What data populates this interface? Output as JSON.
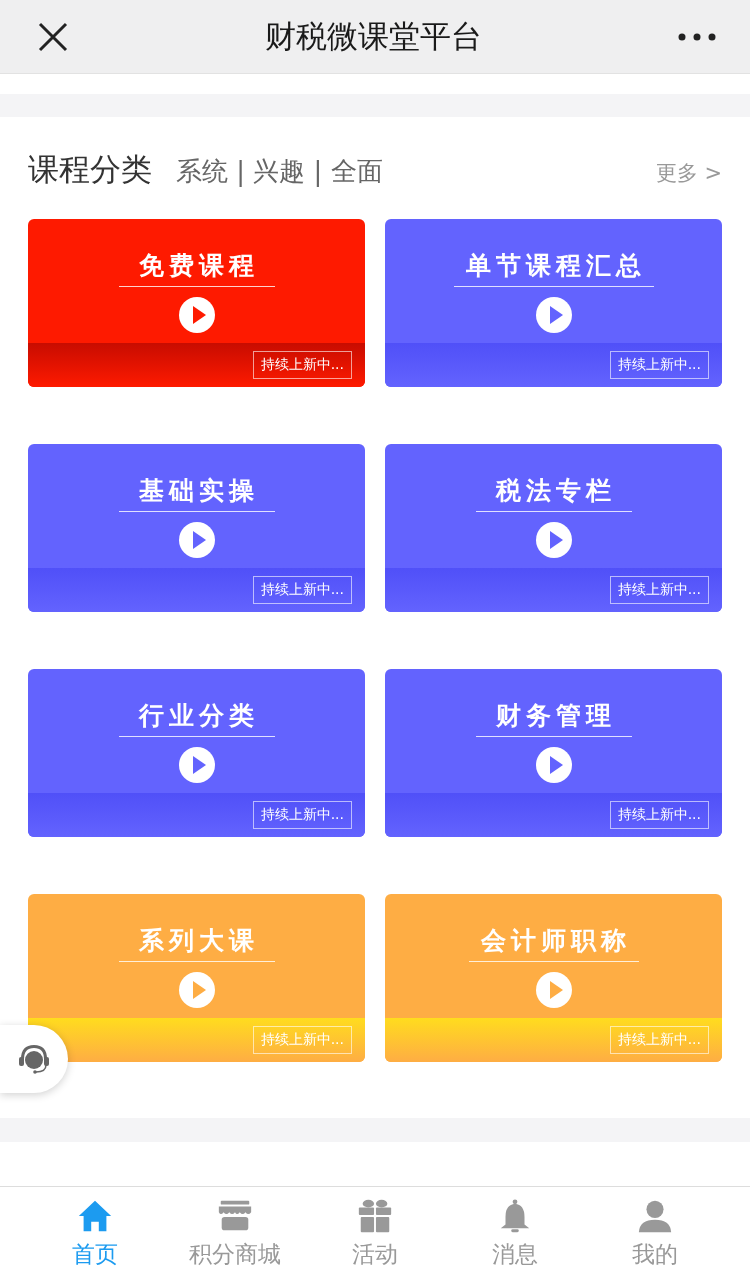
{
  "header": {
    "title": "财税微课堂平台"
  },
  "section": {
    "title": "课程分类",
    "subtitle": "系统 | 兴趣 | 全面",
    "more": "更多 >"
  },
  "cards": [
    {
      "title": "免费课程",
      "badge": "持续上新中...",
      "color": "#fe1a00",
      "band": {
        "color": "#c80c00"
      }
    },
    {
      "title": "单节课程汇总",
      "badge": "持续上新中...",
      "color": "#6363fe",
      "band": {
        "color": "#5050f8"
      }
    },
    {
      "title": "基础实操",
      "badge": "持续上新中...",
      "color": "#6363fe",
      "band": {
        "color": "#5050f8"
      }
    },
    {
      "title": "税法专栏",
      "badge": "持续上新中...",
      "color": "#6363fe",
      "band": {
        "color": "#5050f8"
      }
    },
    {
      "title": "行业分类",
      "badge": "持续上新中...",
      "color": "#6363fe",
      "band": {
        "color": "#5050f8"
      }
    },
    {
      "title": "财务管理",
      "badge": "持续上新中...",
      "color": "#6363fe",
      "band": {
        "color": "#5050f8"
      }
    },
    {
      "title": "系列大课",
      "badge": "持续上新中...",
      "color": "#fead44",
      "band": {
        "color": "#ffdc1e"
      }
    },
    {
      "title": "会计师职称",
      "badge": "持续上新中...",
      "color": "#fead44",
      "band": {
        "color": "#ffdc1e"
      }
    }
  ],
  "tabbar": [
    {
      "label": "首页",
      "kind": "home",
      "selected": true
    },
    {
      "label": "积分商城",
      "kind": "shop",
      "selected": false
    },
    {
      "label": "活动",
      "kind": "gift",
      "selected": false
    },
    {
      "label": "消息",
      "kind": "bell",
      "selected": false
    },
    {
      "label": "我的",
      "kind": "user",
      "selected": false
    }
  ]
}
